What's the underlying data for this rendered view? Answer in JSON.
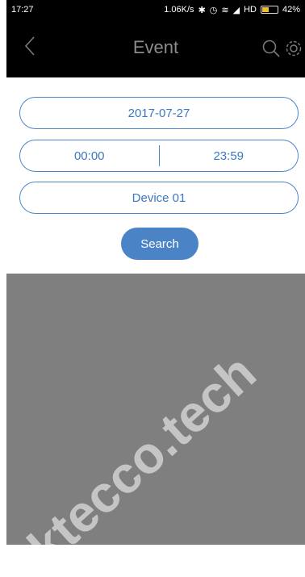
{
  "status_bar": {
    "time": "17:27",
    "speed": "1.06K/s",
    "network": "HD",
    "battery": "42%"
  },
  "nav": {
    "back_icon": "chevron-left-icon",
    "title": "Event",
    "search_icon": "search-icon",
    "settings_icon": "gear-icon"
  },
  "form": {
    "date": "2017-07-27",
    "start_time": "00:00",
    "end_time": "23:59",
    "device": "Device 01",
    "search_label": "Search"
  },
  "watermark": "ktecco.tech",
  "colors": {
    "accent": "#4b84c6",
    "header_bg": "#000000",
    "empty_area": "#7f7f7f"
  }
}
